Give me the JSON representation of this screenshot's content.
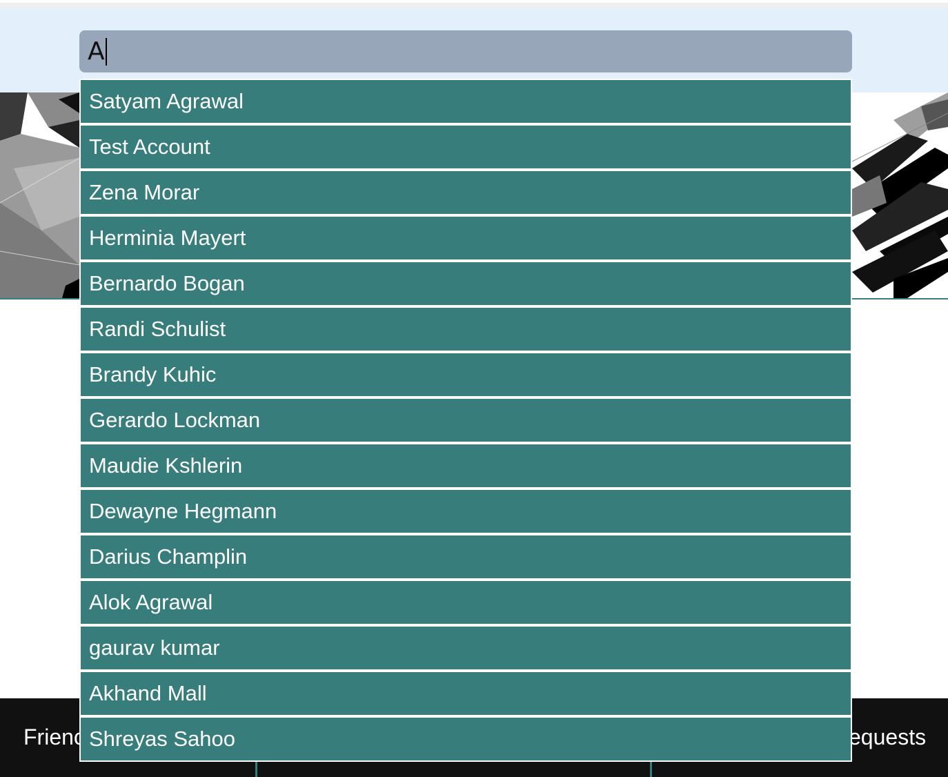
{
  "search": {
    "value": "A"
  },
  "suggestions": [
    "Satyam Agrawal",
    "Test Account",
    "Zena Morar",
    "Herminia Mayert",
    "Bernardo Bogan",
    "Randi Schulist",
    "Brandy Kuhic",
    "Gerardo Lockman",
    "Maudie Kshlerin",
    "Dewayne Hegmann",
    "Darius Champlin",
    "Alok Agrawal",
    "gaurav kumar",
    "Akhand Mall",
    "Shreyas Sahoo"
  ],
  "nav": {
    "left_label": "Frienc",
    "right_label": "equests"
  },
  "colors": {
    "suggestion_bg": "#377d7b",
    "search_bg": "#97a6b9",
    "search_band": "#e3effb",
    "nav_bg": "#111111"
  }
}
